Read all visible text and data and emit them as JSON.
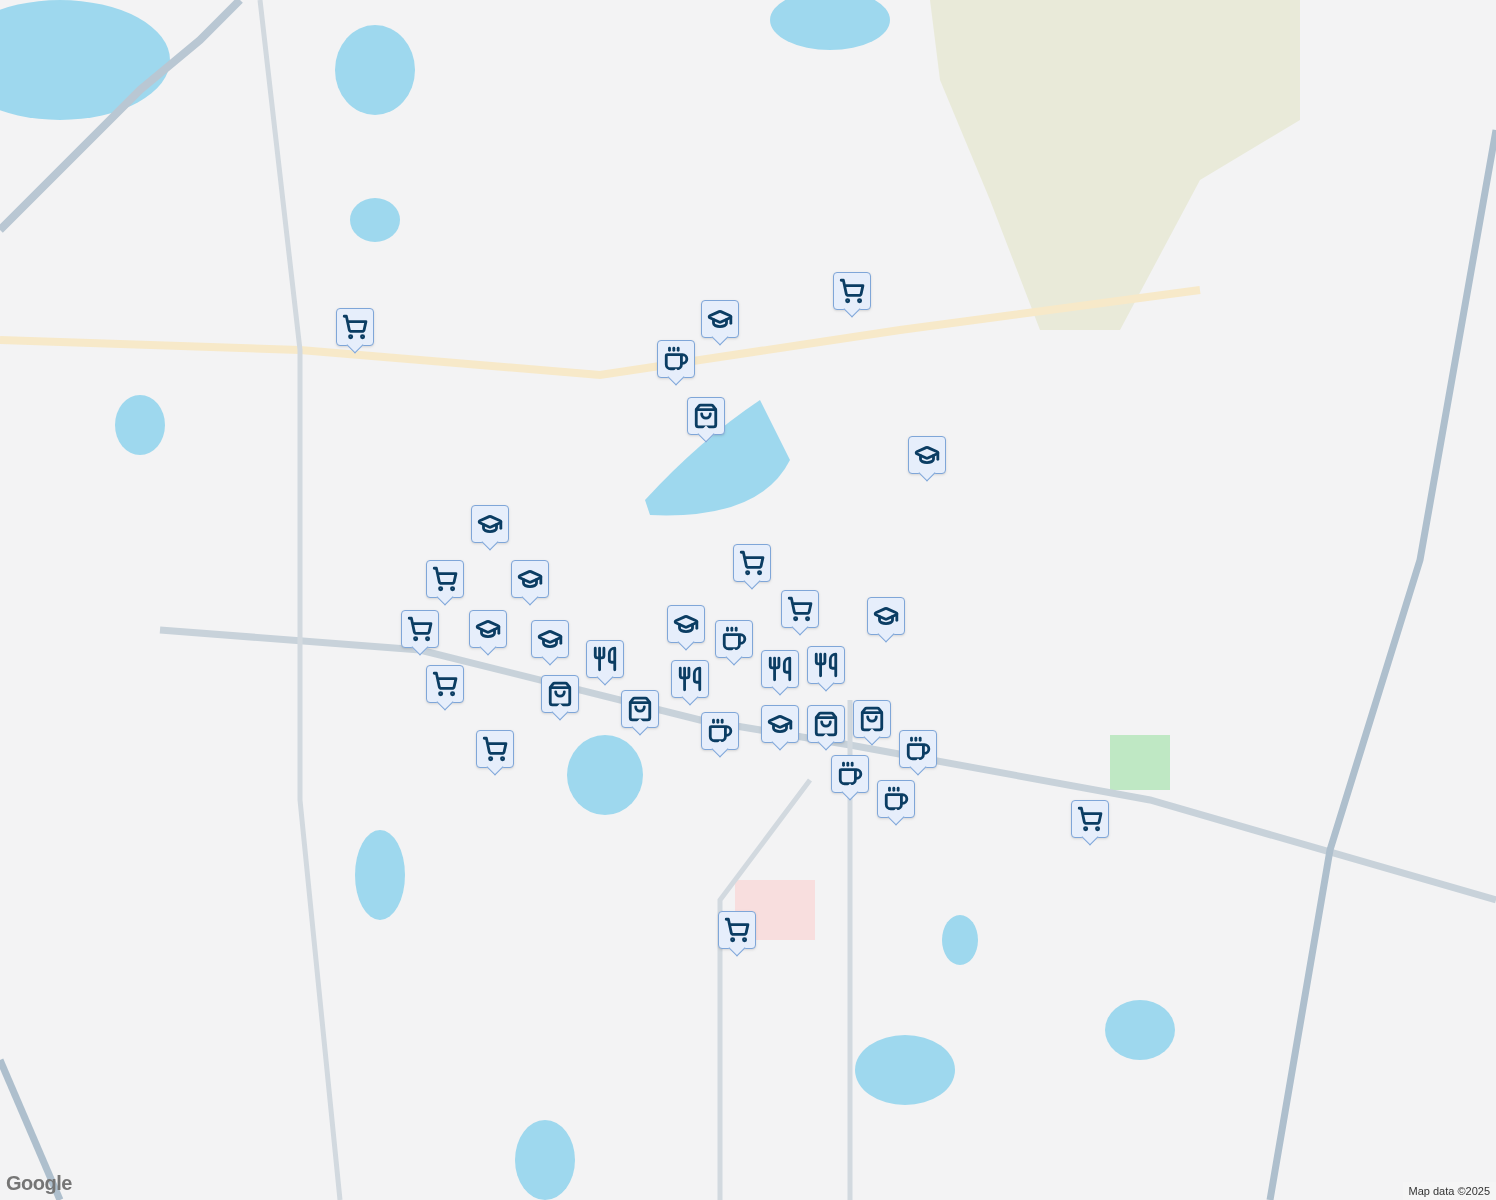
{
  "map": {
    "pins": [
      {
        "kind": "cart"
      },
      {
        "kind": "cart"
      },
      {
        "kind": "school"
      },
      {
        "kind": "cafe"
      },
      {
        "kind": "bag"
      },
      {
        "kind": "school"
      },
      {
        "kind": "school"
      },
      {
        "kind": "cart"
      },
      {
        "kind": "cart"
      },
      {
        "kind": "school"
      },
      {
        "kind": "school"
      },
      {
        "kind": "cart"
      },
      {
        "kind": "cart"
      },
      {
        "kind": "school"
      },
      {
        "kind": "cart"
      },
      {
        "kind": "school"
      },
      {
        "kind": "bag"
      },
      {
        "kind": "restaurant"
      },
      {
        "kind": "bag"
      },
      {
        "kind": "school"
      },
      {
        "kind": "cafe"
      },
      {
        "kind": "restaurant"
      },
      {
        "kind": "restaurant"
      },
      {
        "kind": "restaurant"
      },
      {
        "kind": "cafe"
      },
      {
        "kind": "school"
      },
      {
        "kind": "cart"
      },
      {
        "kind": "bag"
      },
      {
        "kind": "bag"
      },
      {
        "kind": "cafe"
      },
      {
        "kind": "cafe"
      },
      {
        "kind": "cafe"
      },
      {
        "kind": "cart"
      },
      {
        "kind": "cart"
      }
    ],
    "logo": "Google",
    "attribution": "Map data ©2025"
  }
}
